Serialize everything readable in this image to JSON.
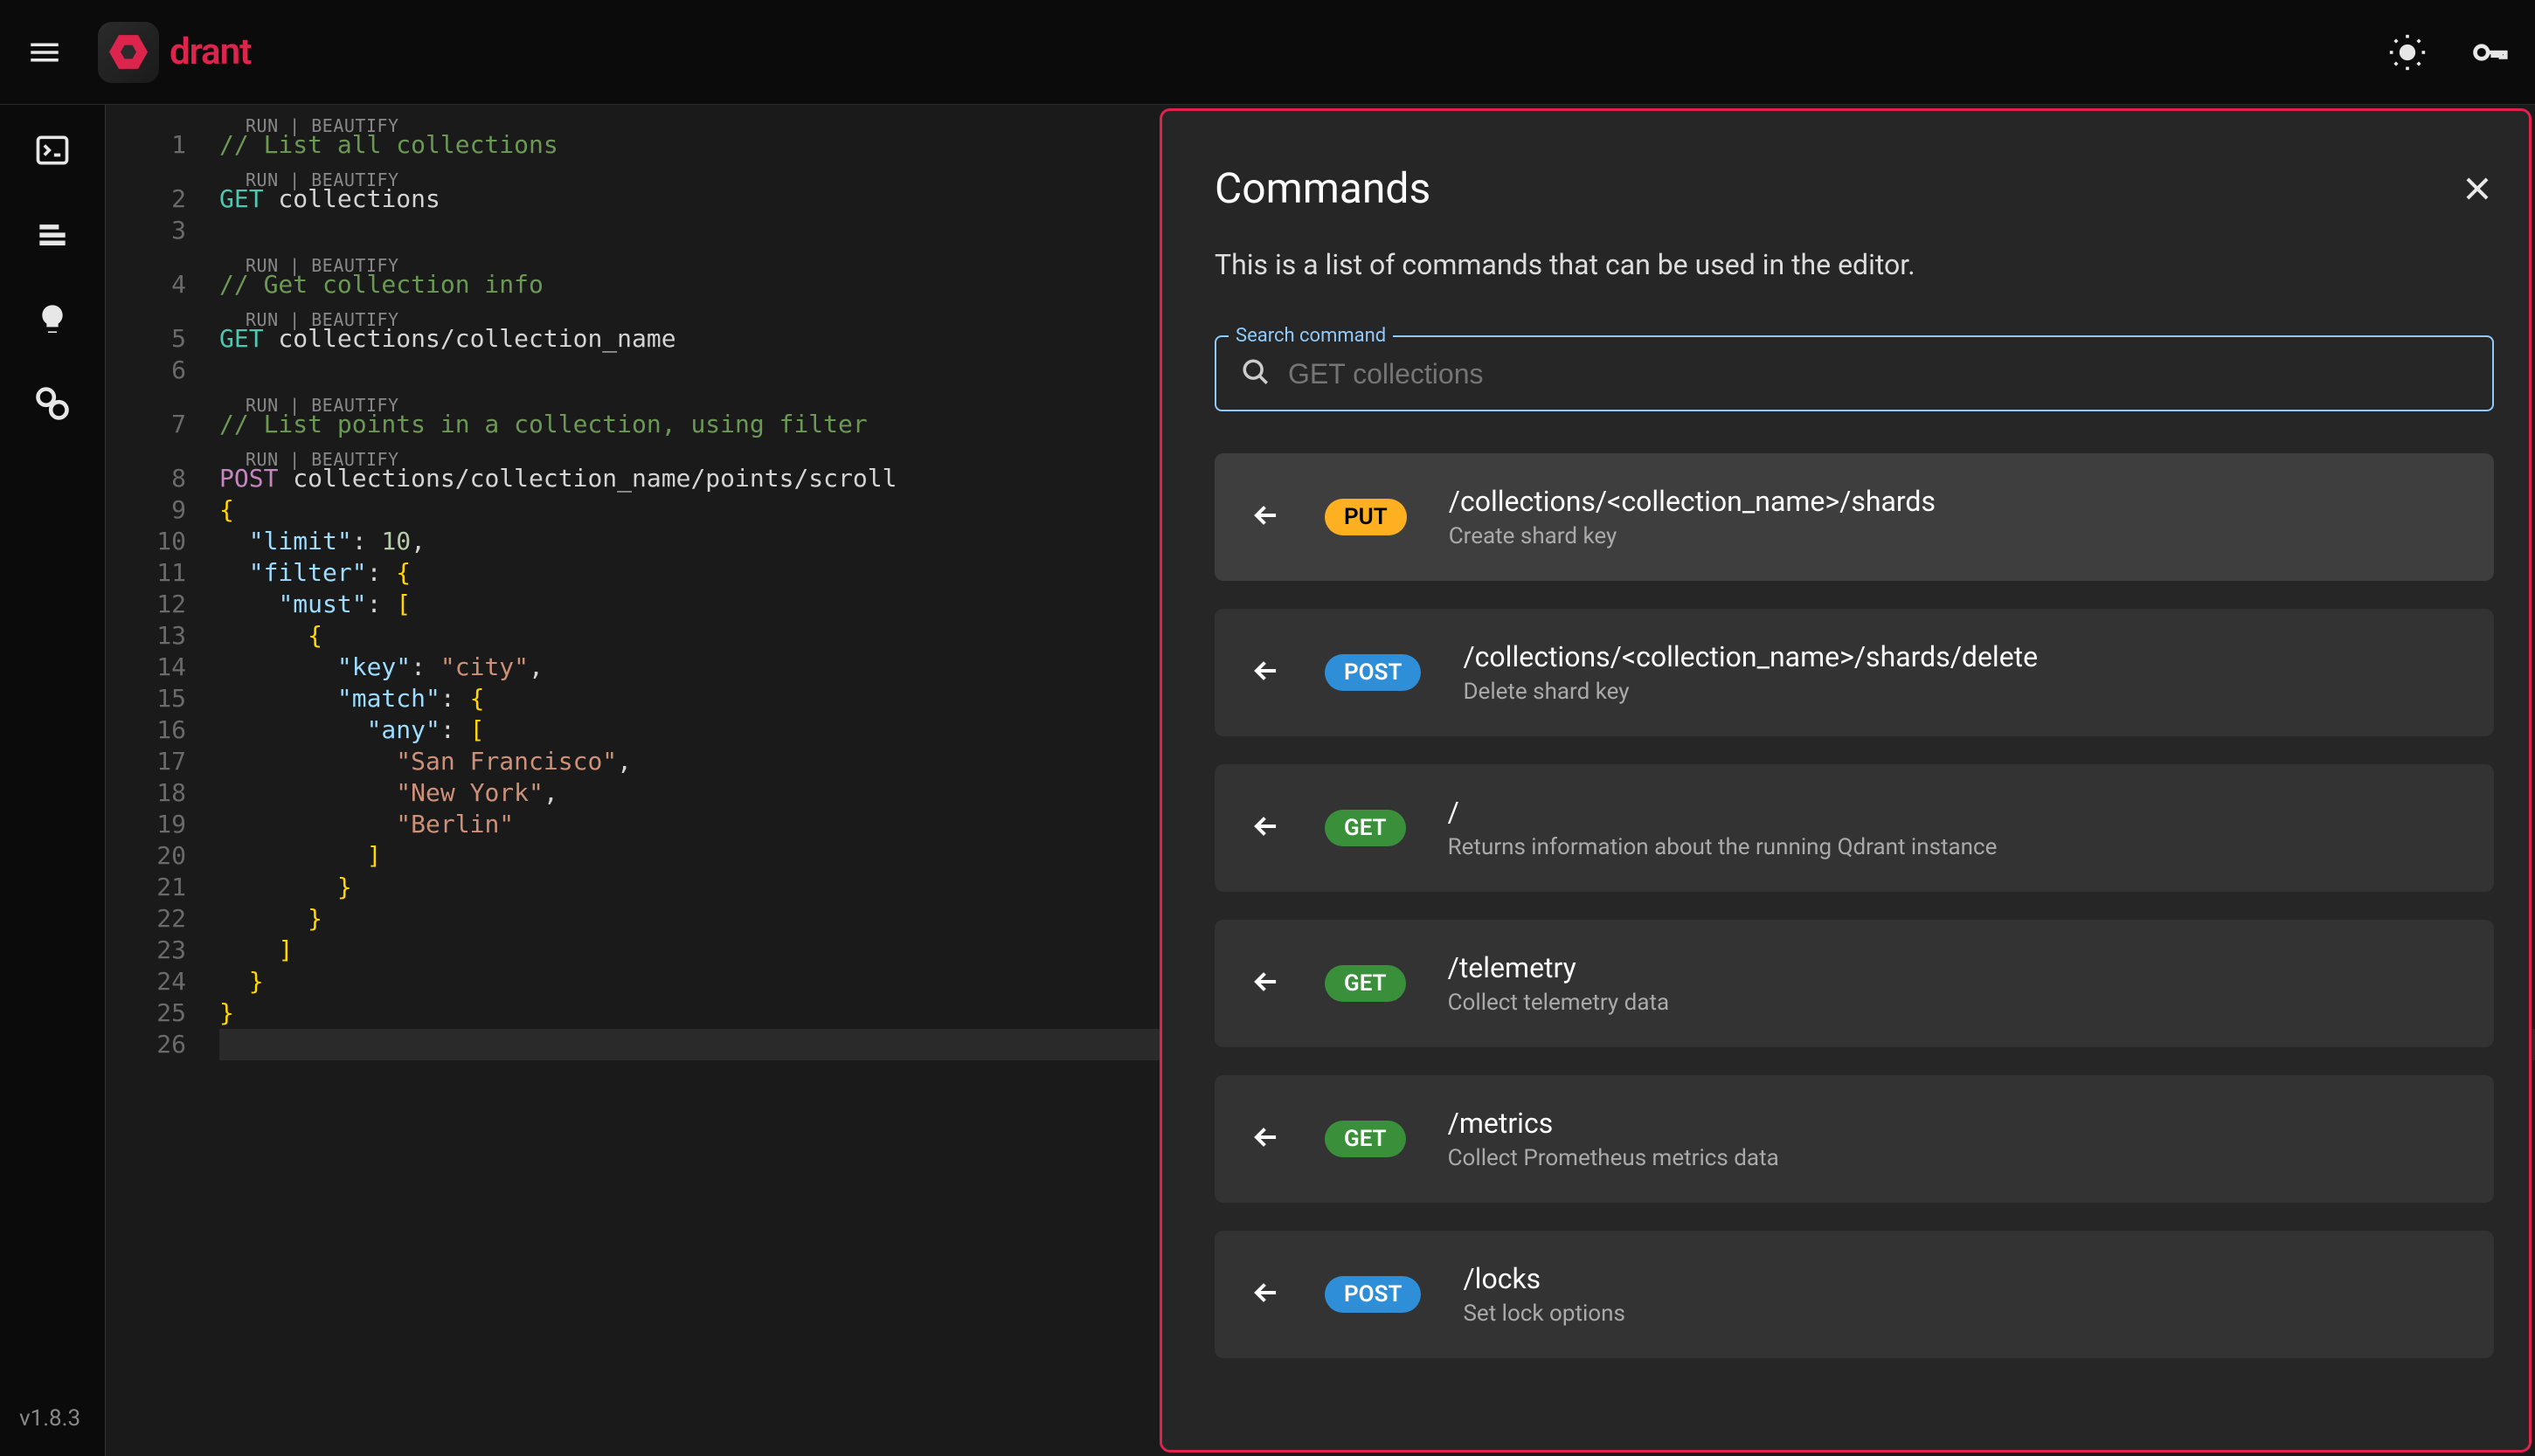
{
  "brand": "drant",
  "version": "v1.8.3",
  "codelens_label": "RUN | BEAUTIFY",
  "editor": {
    "lines": [
      {
        "n": 1,
        "lens": true,
        "tokens": [
          {
            "t": "comment",
            "v": "// List all collections"
          }
        ]
      },
      {
        "n": 2,
        "lens": true,
        "tokens": [
          {
            "t": "get",
            "v": "GET"
          },
          {
            "t": "plain",
            "v": " collections"
          }
        ]
      },
      {
        "n": 3,
        "tokens": []
      },
      {
        "n": 4,
        "lens": true,
        "tokens": [
          {
            "t": "comment",
            "v": "// Get collection info"
          }
        ]
      },
      {
        "n": 5,
        "lens": true,
        "tokens": [
          {
            "t": "get",
            "v": "GET"
          },
          {
            "t": "plain",
            "v": " collections/collection_name"
          }
        ]
      },
      {
        "n": 6,
        "tokens": []
      },
      {
        "n": 7,
        "lens": true,
        "tokens": [
          {
            "t": "comment",
            "v": "// List points in a collection, using filter"
          }
        ]
      },
      {
        "n": 8,
        "lens": true,
        "tokens": [
          {
            "t": "post",
            "v": "POST"
          },
          {
            "t": "plain",
            "v": " collections/collection_name/points/scroll"
          }
        ]
      },
      {
        "n": 9,
        "tokens": [
          {
            "t": "brace",
            "v": "{"
          }
        ]
      },
      {
        "n": 10,
        "tokens": [
          {
            "t": "plain",
            "v": "  "
          },
          {
            "t": "key",
            "v": "\"limit\""
          },
          {
            "t": "punc",
            "v": ": "
          },
          {
            "t": "number",
            "v": "10"
          },
          {
            "t": "punc",
            "v": ","
          }
        ]
      },
      {
        "n": 11,
        "tokens": [
          {
            "t": "plain",
            "v": "  "
          },
          {
            "t": "key",
            "v": "\"filter\""
          },
          {
            "t": "punc",
            "v": ": "
          },
          {
            "t": "brace",
            "v": "{"
          }
        ]
      },
      {
        "n": 12,
        "tokens": [
          {
            "t": "plain",
            "v": "    "
          },
          {
            "t": "key",
            "v": "\"must\""
          },
          {
            "t": "punc",
            "v": ": "
          },
          {
            "t": "brace",
            "v": "["
          }
        ]
      },
      {
        "n": 13,
        "tokens": [
          {
            "t": "plain",
            "v": "      "
          },
          {
            "t": "brace",
            "v": "{"
          }
        ]
      },
      {
        "n": 14,
        "tokens": [
          {
            "t": "plain",
            "v": "        "
          },
          {
            "t": "key",
            "v": "\"key\""
          },
          {
            "t": "punc",
            "v": ": "
          },
          {
            "t": "string",
            "v": "\"city\""
          },
          {
            "t": "punc",
            "v": ","
          }
        ]
      },
      {
        "n": 15,
        "tokens": [
          {
            "t": "plain",
            "v": "        "
          },
          {
            "t": "key",
            "v": "\"match\""
          },
          {
            "t": "punc",
            "v": ": "
          },
          {
            "t": "brace",
            "v": "{"
          }
        ]
      },
      {
        "n": 16,
        "tokens": [
          {
            "t": "plain",
            "v": "          "
          },
          {
            "t": "key",
            "v": "\"any\""
          },
          {
            "t": "punc",
            "v": ": "
          },
          {
            "t": "brace",
            "v": "["
          }
        ]
      },
      {
        "n": 17,
        "tokens": [
          {
            "t": "plain",
            "v": "            "
          },
          {
            "t": "string",
            "v": "\"San Francisco\""
          },
          {
            "t": "punc",
            "v": ","
          }
        ]
      },
      {
        "n": 18,
        "tokens": [
          {
            "t": "plain",
            "v": "            "
          },
          {
            "t": "string",
            "v": "\"New York\""
          },
          {
            "t": "punc",
            "v": ","
          }
        ]
      },
      {
        "n": 19,
        "tokens": [
          {
            "t": "plain",
            "v": "            "
          },
          {
            "t": "string",
            "v": "\"Berlin\""
          }
        ]
      },
      {
        "n": 20,
        "tokens": [
          {
            "t": "plain",
            "v": "          "
          },
          {
            "t": "brace",
            "v": "]"
          }
        ]
      },
      {
        "n": 21,
        "tokens": [
          {
            "t": "plain",
            "v": "        "
          },
          {
            "t": "brace",
            "v": "}"
          }
        ]
      },
      {
        "n": 22,
        "tokens": [
          {
            "t": "plain",
            "v": "      "
          },
          {
            "t": "brace",
            "v": "}"
          }
        ]
      },
      {
        "n": 23,
        "tokens": [
          {
            "t": "plain",
            "v": "    "
          },
          {
            "t": "brace",
            "v": "]"
          }
        ]
      },
      {
        "n": 24,
        "tokens": [
          {
            "t": "plain",
            "v": "  "
          },
          {
            "t": "brace",
            "v": "}"
          }
        ]
      },
      {
        "n": 25,
        "tokens": [
          {
            "t": "brace",
            "v": "}"
          }
        ]
      },
      {
        "n": 26,
        "active": true,
        "tokens": []
      }
    ]
  },
  "panel": {
    "title": "Commands",
    "subtitle": "This is a list of commands that can be used in the editor.",
    "search_label": "Search command",
    "search_placeholder": "GET collections",
    "items": [
      {
        "method": "PUT",
        "path": "/collections/<collection_name>/shards",
        "desc": "Create shard key",
        "hover": true
      },
      {
        "method": "POST",
        "path": "/collections/<collection_name>/shards/delete",
        "desc": "Delete shard key"
      },
      {
        "method": "GET",
        "path": "/",
        "desc": "Returns information about the running Qdrant instance"
      },
      {
        "method": "GET",
        "path": "/telemetry",
        "desc": "Collect telemetry data"
      },
      {
        "method": "GET",
        "path": "/metrics",
        "desc": "Collect Prometheus metrics data"
      },
      {
        "method": "POST",
        "path": "/locks",
        "desc": "Set lock options"
      }
    ]
  }
}
